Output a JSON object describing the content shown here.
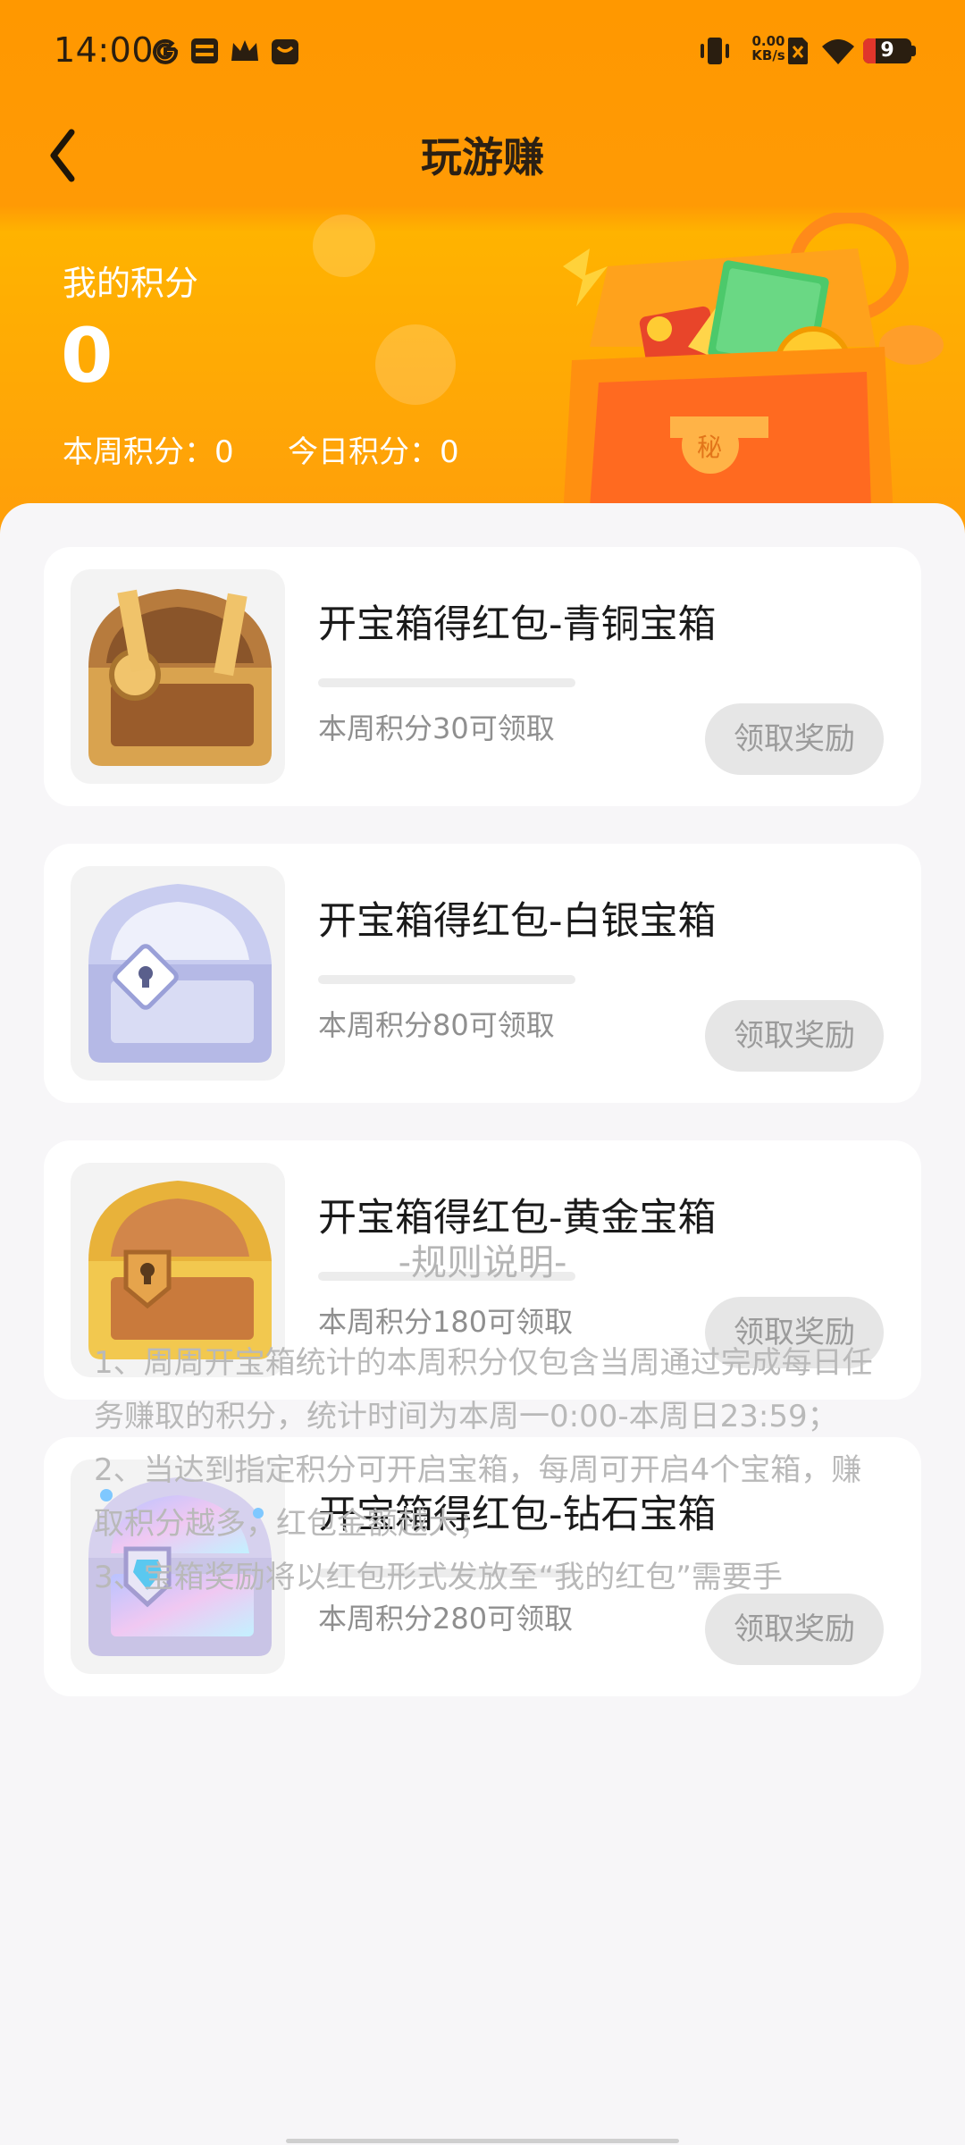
{
  "status_bar": {
    "time": "14:00",
    "net_speed_value": "0.00",
    "net_speed_unit": "KB/s",
    "battery": "9",
    "icons": [
      "google-g-icon",
      "wallet-icon",
      "crown-icon",
      "briefcase-icon",
      "vibrate-icon",
      "no-sim-icon",
      "wifi-icon",
      "battery-icon"
    ]
  },
  "nav": {
    "back_icon": "chevron-left-icon",
    "title": "玩游赚"
  },
  "points": {
    "label": "我的积分",
    "value": "0",
    "weekly_label": "本周积分：",
    "weekly_value": "0",
    "daily_label": "今日积分：",
    "daily_value": "0"
  },
  "rewards": [
    {
      "title": "开宝箱得红包-青铜宝箱",
      "hint": "本周积分30可领取",
      "button": "领取奖励",
      "progress": 0,
      "icon": "bronze-chest-icon"
    },
    {
      "title": "开宝箱得红包-白银宝箱",
      "hint": "本周积分80可领取",
      "button": "领取奖励",
      "progress": 0,
      "icon": "silver-chest-icon"
    },
    {
      "title": "开宝箱得红包-黄金宝箱",
      "hint": "本周积分180可领取",
      "button": "领取奖励",
      "progress": 0,
      "icon": "gold-chest-icon"
    },
    {
      "title": "开宝箱得红包-钻石宝箱",
      "hint": "本周积分280可领取",
      "button": "领取奖励",
      "progress": 0,
      "icon": "diamond-chest-icon"
    }
  ],
  "rules": {
    "title": "-规则说明-",
    "items": [
      "1、周周开宝箱统计的本周积分仅包含当周通过完成每日任务赚取的积分，统计时间为本周一0:00-本周日23:59；",
      "2、当达到指定积分可开启宝箱，每周可开启4个宝箱，赚取积分越多，红包金额越大；",
      "3、宝箱奖励将以红包形式发放至“我的红包”需要手"
    ]
  },
  "colors": {
    "header": "#ff9800",
    "accent": "#ffb300",
    "button_bg": "#e6e6e6",
    "button_text": "#9b9b9b"
  }
}
